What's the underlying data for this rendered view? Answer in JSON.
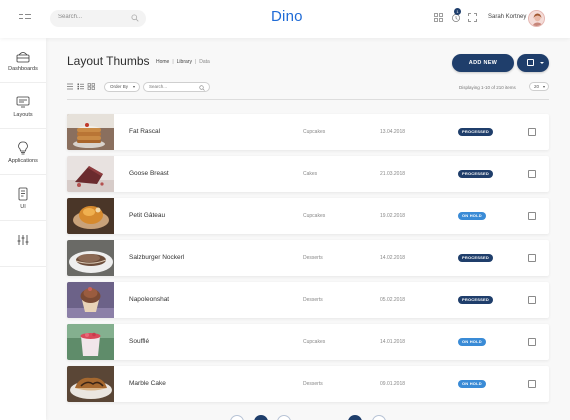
{
  "app": {
    "logo": "Dino",
    "search_placeholder": "Search...",
    "user_name": "Sarah Kortney",
    "notification_count": "1"
  },
  "sidebar": {
    "items": [
      {
        "label": "Dashboards",
        "icon": "dashboard-icon"
      },
      {
        "label": "Layouts",
        "icon": "layouts-icon"
      },
      {
        "label": "Applications",
        "icon": "lightbulb-icon"
      },
      {
        "label": "UI",
        "icon": "ui-icon"
      },
      {
        "label": "",
        "icon": "menu-settings-icon"
      }
    ]
  },
  "page": {
    "title": "Layout Thumbs",
    "breadcrumb": [
      "Home",
      "Library",
      "Data"
    ],
    "add_button": "ADD NEW",
    "order_by": "Order By",
    "filter_placeholder": "Search...",
    "displaying": "Displaying 1-10 of 210 items",
    "per_page": "20"
  },
  "colors": {
    "accent": "#1f3e6b",
    "processed": "#1f3e6b",
    "on_hold": "#3a8bd6",
    "logo": "#1f6bd6"
  },
  "items": [
    {
      "name": "Fat Rascal",
      "category": "Cupcakes",
      "date": "13.04.2018",
      "status": "PROCESSED"
    },
    {
      "name": "Goose Breast",
      "category": "Cakes",
      "date": "21.03.2018",
      "status": "PROCESSED"
    },
    {
      "name": "Petit Gâteau",
      "category": "Cupcakes",
      "date": "19.02.2018",
      "status": "ON HOLD"
    },
    {
      "name": "Salzburger Nockerl",
      "category": "Desserts",
      "date": "14.02.2018",
      "status": "PROCESSED"
    },
    {
      "name": "Napoleonshat",
      "category": "Desserts",
      "date": "05.02.2018",
      "status": "PROCESSED"
    },
    {
      "name": "Soufflé",
      "category": "Cupcakes",
      "date": "14.01.2018",
      "status": "ON HOLD"
    },
    {
      "name": "Marble Cake",
      "category": "Desserts",
      "date": "09.01.2018",
      "status": "ON HOLD"
    }
  ]
}
